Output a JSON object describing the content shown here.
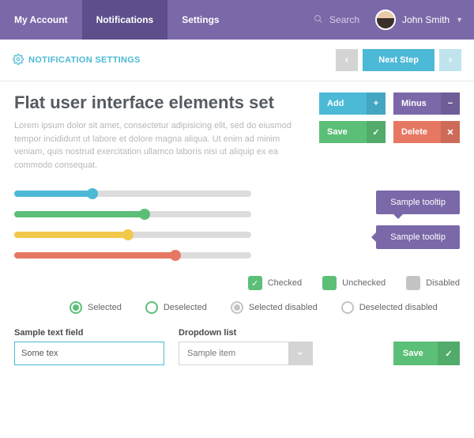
{
  "nav": {
    "items": [
      "My Account",
      "Notifications",
      "Settings"
    ],
    "active_index": 1,
    "search_label": "Search",
    "user_name": "John Smith"
  },
  "subbar": {
    "title": "NOTIFICATION SETTINGS",
    "next_label": "Next Step"
  },
  "hero": {
    "title": "Flat user interface elements set",
    "lorem": "Lorem ipsum dolor sit amet, consectetur adipisicing elit, sed do eiusmod tempor incididunt ut labore et dolore magna aliqua. Ut enim ad minim veniam, quis nostrud exercitation ullamco laboris nisi ut aliquip ex ea commodo consequat."
  },
  "buttons": {
    "add": "Add",
    "minus": "Minus",
    "save": "Save",
    "delete": "Delete"
  },
  "sliders": [
    {
      "color": "teal",
      "value": 33
    },
    {
      "color": "green",
      "value": 55
    },
    {
      "color": "yellow",
      "value": 48
    },
    {
      "color": "coral",
      "value": 68
    }
  ],
  "tooltip_label": "Sample tooltip",
  "checkboxes": {
    "checked": "Checked",
    "unchecked": "Unchecked",
    "disabled": "Disabled"
  },
  "radios": {
    "selected": "Selected",
    "deselected": "Deselected",
    "selected_disabled": "Selected disabled",
    "deselected_disabled": "Deselected disabled"
  },
  "form": {
    "text_label": "Sample text field",
    "text_value": "Some tex",
    "dropdown_label": "Dropdown list",
    "dropdown_value": "Sample item",
    "save_label": "Save"
  }
}
